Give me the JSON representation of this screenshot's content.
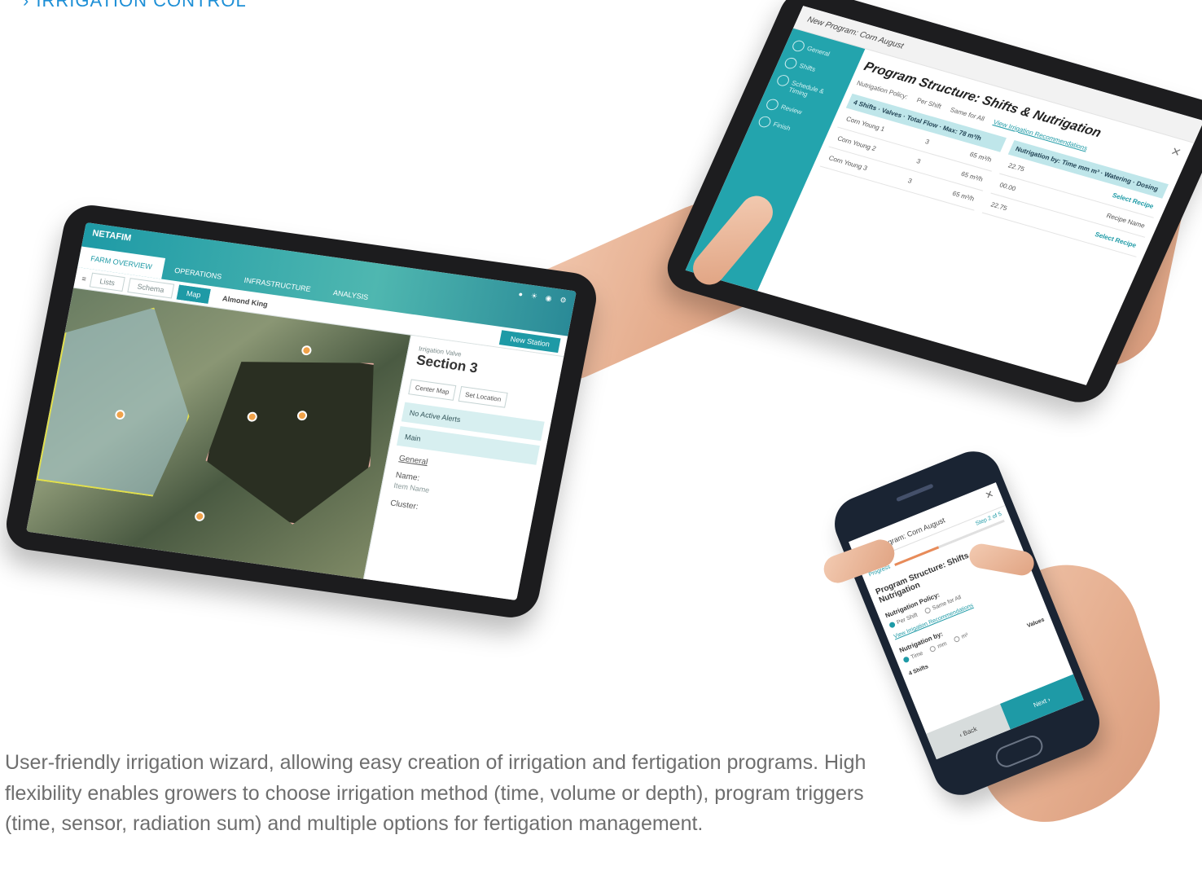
{
  "section": {
    "chevron": "›",
    "title": "IRRIGATION CONTROL"
  },
  "caption": "User-friendly irrigation wizard, allowing easy creation of irrigation and fertigation programs. High flexibility enables growers to choose irrigation method (time, volume or depth), program triggers (time, sensor, radiation sum) and multiple options for fertigation management.",
  "tablet_left": {
    "logo": "NETAFIM",
    "nav": [
      "FARM OVERVIEW",
      "OPERATIONS",
      "INFRASTRUCTURE",
      "ANALYSIS"
    ],
    "views": [
      "Lists",
      "Schema",
      "Map"
    ],
    "place": "Almond King",
    "new_station": "New Station",
    "panel": {
      "subtitle": "Irrigation Valve",
      "title": "Section 3",
      "center_map": "Center Map",
      "set_location": "Set Location",
      "alerts": "No Active Alerts",
      "main": "Main",
      "general": "General",
      "name_label": "Name:",
      "name_value": "Item Name",
      "cluster_label": "Cluster:"
    }
  },
  "tablet_right": {
    "header": "New Program: Corn August",
    "steps": [
      "General",
      "Shifts",
      "Schedule & Timing",
      "Review",
      "Finish"
    ],
    "title": "Program Structure: Shifts & Nutrigation",
    "policy_label": "Nutrigation Policy:",
    "policy_opt1": "Per Shift",
    "policy_opt2": "Same for All",
    "link": "View Irrigation Recommendations",
    "shifts_header": "4 Shifts",
    "values_header": "Valves",
    "flow_header": "Total Flow",
    "max_label": "Max: 78 m³/h",
    "nut_by": "Nutrigation by:",
    "nut_opts": [
      "Time",
      "mm",
      "m³"
    ],
    "watering": "Watering",
    "dosing": "Dosing",
    "rows": [
      {
        "shift": "Corn Young 1",
        "valves": "3",
        "flow": "65 m³/h",
        "watering": "22.75",
        "dosing": "Select Recipe"
      },
      {
        "shift": "Corn Young 2",
        "valves": "3",
        "flow": "65 m³/h",
        "watering": "00.00",
        "dosing": "Recipe Name"
      },
      {
        "shift": "Corn Young 3",
        "valves": "3",
        "flow": "65 m³/h",
        "watering": "22.75",
        "dosing": "Select Recipe"
      }
    ]
  },
  "phone": {
    "header": "New Program: Corn August",
    "step": "Step 2 of 5",
    "progress": "Progress",
    "progress_value": 0.4,
    "title": "Program Structure: Shifts & Nutrigation",
    "policy_label": "Nutrigation Policy:",
    "policy_opts": [
      "Per Shift",
      "Same for All"
    ],
    "link": "View Irrigation Recommendations",
    "nut_by": "Nutrigation by:",
    "nut_opts": [
      "Time",
      "mm",
      "m³"
    ],
    "shifts": "4 Shifts",
    "values": "Values",
    "back": "‹ Back",
    "next": "Next ›"
  },
  "colors": {
    "accent": "#1e9aa6",
    "title": "#1d8fd6",
    "orange": "#e88b59"
  }
}
